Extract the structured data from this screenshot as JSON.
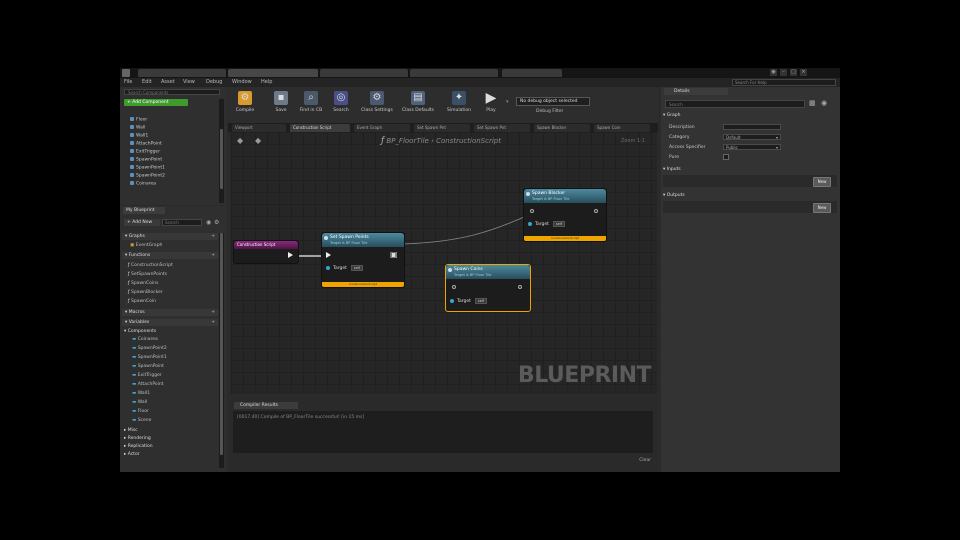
{
  "window": {
    "doc_tabs": [
      "",
      "",
      "",
      "",
      ""
    ],
    "help_text": "Search For Help"
  },
  "menu": [
    "File",
    "Edit",
    "Asset",
    "View",
    "Debug",
    "Window",
    "Help"
  ],
  "components": {
    "search_placeholder": "Search Components",
    "add_button": "+ Add Component",
    "items": [
      "Floor",
      "Wall",
      "Wall1",
      "AttachPoint",
      "ExitTrigger",
      "SpawnPoint",
      "SpawnPoint1",
      "SpawnPoint2",
      "Coinarea"
    ]
  },
  "my_blueprint": {
    "tab": "My Blueprint",
    "add_new": "+ Add New",
    "search_placeholder": "Search",
    "sections": {
      "graphs": "Graphs",
      "event_graph": "EventGraph",
      "functions": "Functions",
      "macros": "Macros",
      "variables": "Variables",
      "components": "Components",
      "misc": "Misc",
      "rendering": "Rendering",
      "replication": "Replication",
      "actor": "Actor"
    },
    "functions": [
      "ConstructionScript",
      "SetSpawnPoints",
      "SpawnCoins",
      "SpawnBlocker",
      "SpawnCoin"
    ],
    "component_vars": [
      "Coinarea",
      "SpawnPoint2",
      "SpawnPoint1",
      "SpawnPoint",
      "ExitTrigger",
      "AttachPoint",
      "Wall1",
      "Wall",
      "Floor",
      "Scene"
    ]
  },
  "toolbar": {
    "buttons": [
      "Compile",
      "Save",
      "Find in CB",
      "Search",
      "Class Settings",
      "Class Defaults",
      "Simulation",
      "Play"
    ],
    "debug_select": "No debug object selected",
    "debug_filter": "Debug Filter"
  },
  "graph_tabs": [
    "Viewport",
    "Construction Script",
    "Event Graph",
    "Set Spawn Pnt",
    "Set Spawn Pnt",
    "Spawn Blocker",
    "Spawn Coin"
  ],
  "graph": {
    "breadcrumb_fn": "BP_FloorTile",
    "breadcrumb_sep": "›",
    "breadcrumb_graph": "ConstructionScript",
    "zoom": "Zoom 1:1",
    "watermark": "BLUEPRINT",
    "nodes": {
      "construction": "Construction Script",
      "set_spawn": {
        "title": "Set Spawn Points",
        "subtitle": "Target is BP Floor Tile",
        "pin_target": "Target",
        "self": "self",
        "footer": "ConstructionScript"
      },
      "spawn_coins": {
        "title": "Spawn Coins",
        "subtitle": "Target is BP Floor Tile",
        "pin_target": "Target",
        "self": "self"
      },
      "spawn_blocker": {
        "title": "Spawn Blocker",
        "subtitle": "Target is BP Floor Tile",
        "pin_target": "Target",
        "self": "self",
        "footer": "ConstructionScript"
      }
    }
  },
  "compiler": {
    "tab": "Compiler Results",
    "message": "[0017.40] Compile of BP_FloorTile successful! [in 15 ms]",
    "clear": "Clear"
  },
  "details": {
    "tab": "Details",
    "search_placeholder": "Search",
    "graph_header": "Graph",
    "description_label": "Description",
    "category_label": "Category",
    "access_label": "Access Specifier",
    "pure_label": "Pure",
    "category_value": "Default",
    "access_value": "Public",
    "inputs_header": "Inputs",
    "outputs_header": "Outputs",
    "new_button": "New"
  },
  "colors": {
    "exec_footer": "#f0a400",
    "node_header": "#3e7d93",
    "event_header": "#7a1a6b",
    "selected_outline": "#f0a400"
  }
}
